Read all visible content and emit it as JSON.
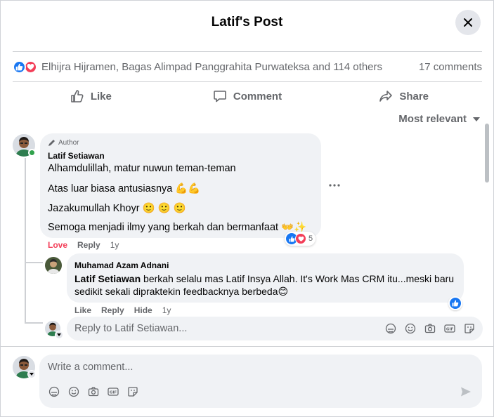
{
  "dialog": {
    "title": "Latif's Post",
    "close_icon": "close-icon"
  },
  "post": {
    "reaction_icons": [
      "like-icon",
      "love-icon"
    ],
    "reactors_text": "Elhijra Hijramen, Bagas Alimpad Panggrahita Purwateksa and 114 others",
    "comments_count": "17 comments",
    "actions": {
      "like": "Like",
      "comment": "Comment",
      "share": "Share"
    },
    "sort_label": "Most relevant"
  },
  "comment": {
    "badge": "Author",
    "author": "Latif Setiawan",
    "lines": [
      "Alhamdulillah, matur nuwun teman-teman",
      "Atas luar biasa antusiasnya 💪💪",
      "Jazakumullah Khoyr 🙂 🙂 🙂",
      "Semoga menjadi ilmy yang berkah dan bermanfaat 👐✨"
    ],
    "reaction_count": "5",
    "love_label": "Love",
    "reply_label": "Reply",
    "time": "1y"
  },
  "reply": {
    "author": "Muhamad Azam Adnani",
    "mention": "Latif Setiawan",
    "text": " berkah selalu mas Latif Insya Allah. It's Work Mas CRM itu...meski baru sedikit sekali dipraktekin feedbacknya berbeda😊",
    "like_label": "Like",
    "reply_label": "Reply",
    "hide_label": "Hide",
    "time": "1y"
  },
  "reply_input": {
    "placeholder": "Reply to Latif Setiawan..."
  },
  "comment_input": {
    "placeholder": "Write a comment..."
  },
  "colors": {
    "like_blue": "#1877f2",
    "love_red": "#f33e58",
    "secondary_text": "#65676b",
    "bubble_bg": "#f0f2f5"
  }
}
